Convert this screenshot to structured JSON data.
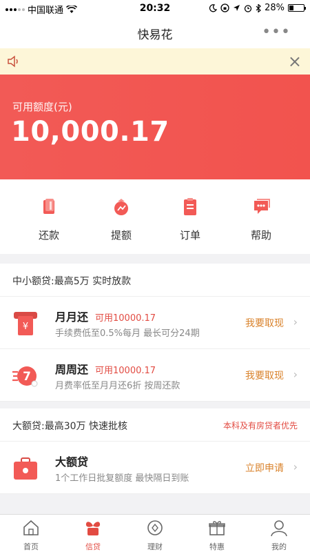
{
  "status_bar": {
    "carrier": "中国联通",
    "time": "20:32",
    "battery": "28%"
  },
  "nav": {
    "title": "快易花",
    "more": "•••"
  },
  "notice": {
    "close": "×"
  },
  "credit": {
    "label": "可用额度(元)",
    "amount": "10,000.17"
  },
  "quick_actions": [
    {
      "label": "还款",
      "icon": "repay-icon"
    },
    {
      "label": "提额",
      "icon": "raise-limit-icon"
    },
    {
      "label": "订单",
      "icon": "order-icon"
    },
    {
      "label": "帮助",
      "icon": "help-icon"
    }
  ],
  "small_loan": {
    "title": "中小额贷:最高5万 实时放款",
    "products": [
      {
        "name": "月月还",
        "available": "可用10000.17",
        "desc": "手续费低至0.5%每月 最长可分24期",
        "action": "我要取现",
        "icon": "monthly-repay-icon"
      },
      {
        "name": "周周还",
        "available": "可用10000.17",
        "desc": "月费率低至月月还6折 按周还款",
        "action": "我要取现",
        "icon": "weekly-repay-icon"
      }
    ]
  },
  "big_loan": {
    "title": "大额贷:最高30万 快速批核",
    "tag": "本科及有房贷者优先",
    "products": [
      {
        "name": "大额贷",
        "desc": "1个工作日批复额度 最快隔日到账",
        "action": "立即申请",
        "icon": "briefcase-icon"
      }
    ]
  },
  "tabs": [
    {
      "label": "首页",
      "icon": "home-icon",
      "active": false
    },
    {
      "label": "信贷",
      "icon": "credit-plant-icon",
      "active": true
    },
    {
      "label": "理财",
      "icon": "finance-icon",
      "active": false
    },
    {
      "label": "特惠",
      "icon": "gift-icon",
      "active": false
    },
    {
      "label": "我的",
      "icon": "profile-icon",
      "active": false
    }
  ],
  "colors": {
    "brand_red": "#f25a56",
    "accent_orange": "#d9822b",
    "notice_bg": "#fdf6d8"
  }
}
